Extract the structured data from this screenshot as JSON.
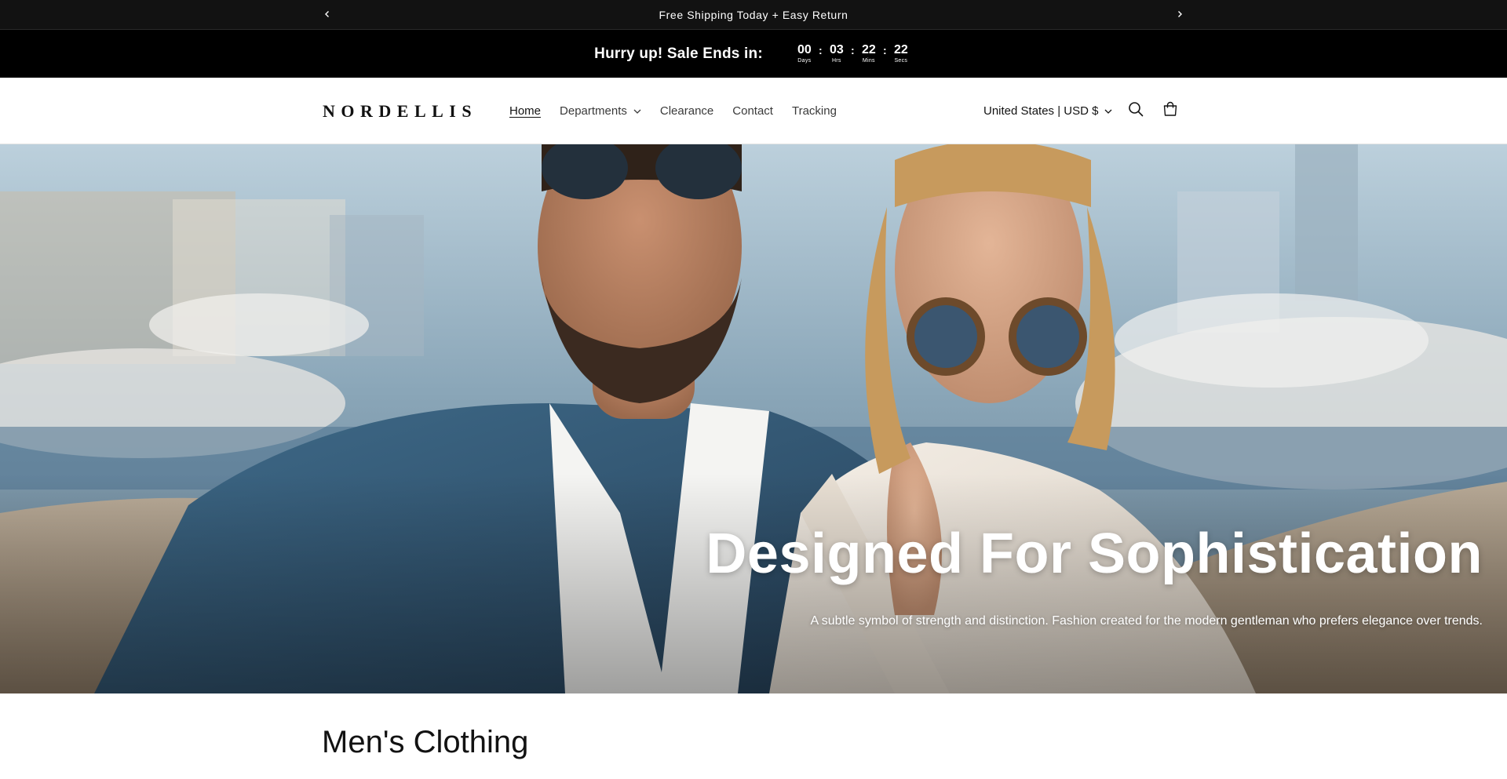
{
  "announcement": {
    "text": "Free Shipping Today + Easy Return",
    "prev_icon": "chevron-left-icon",
    "next_icon": "chevron-right-icon"
  },
  "countdown": {
    "headline": "Hurry up! Sale Ends in:",
    "days": "00",
    "days_label": "Days",
    "hours": "03",
    "hours_label": "Hrs",
    "mins": "22",
    "mins_label": "Mins",
    "secs": "22",
    "secs_label": "Secs"
  },
  "header": {
    "logo": "NORDELLIS",
    "nav": {
      "home": "Home",
      "departments": "Departments",
      "clearance": "Clearance",
      "contact": "Contact",
      "tracking": "Tracking"
    },
    "currency": "United States | USD $",
    "search_icon": "search-icon",
    "cart_icon": "cart-icon"
  },
  "hero": {
    "title": "Designed For Sophistication",
    "subtitle": "A subtle symbol of strength and distinction. Fashion created for the modern gentleman who prefers elegance over trends."
  },
  "section": {
    "title": "Men's Clothing"
  },
  "colors": {
    "announcement_bg": "#121212",
    "countdown_bg": "#000000",
    "text": "#121212",
    "hero_text": "#ffffff"
  }
}
